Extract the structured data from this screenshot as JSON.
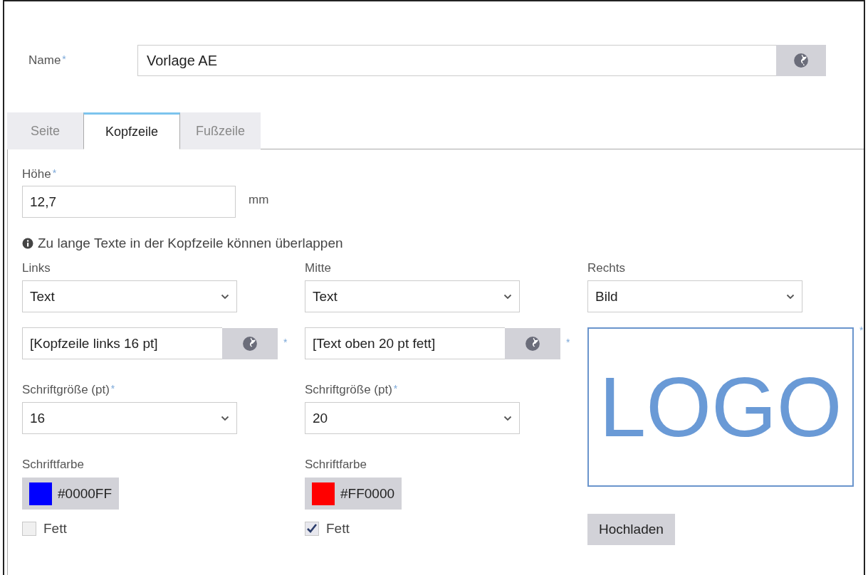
{
  "name_field": {
    "label": "Name",
    "required_mark": "*",
    "value": "Vorlage AE"
  },
  "tabs": [
    {
      "label": "Seite",
      "selected": false
    },
    {
      "label": "Kopfzeile",
      "selected": true
    },
    {
      "label": "Fußzeile",
      "selected": false
    }
  ],
  "height_field": {
    "label": "Höhe",
    "required_mark": "*",
    "value": "12,7",
    "unit": "mm"
  },
  "info": "Zu lange Texte in der Kopfzeile können überlappen",
  "sections": [
    {
      "kind": "text",
      "label": "Links",
      "type_value": "Text",
      "text_value": "[Kopfzeile links 16 pt]",
      "required_mark": "*",
      "font_size_label": "Schriftgröße (pt)",
      "font_size_required_mark": "*",
      "font_size": "16",
      "color_label": "Schriftfarbe",
      "color": "#0000ff",
      "color_text": "#0000FF",
      "bold_label": "Fett",
      "checked": false
    },
    {
      "kind": "text",
      "label": "Mitte",
      "type_value": "Text",
      "text_value": "[Text oben 20 pt fett]",
      "required_mark": "*",
      "font_size_label": "Schriftgröße (pt)",
      "font_size_required_mark": "*",
      "font_size": "20",
      "color_label": "Schriftfarbe",
      "color": "#ff0000",
      "color_text": "#FF0000",
      "bold_label": "Fett",
      "checked": true
    },
    {
      "kind": "image",
      "label": "Rechts",
      "type_value": "Bild",
      "image_text": "LOGO",
      "required_mark": "*",
      "upload_button": "Hochladen"
    }
  ]
}
